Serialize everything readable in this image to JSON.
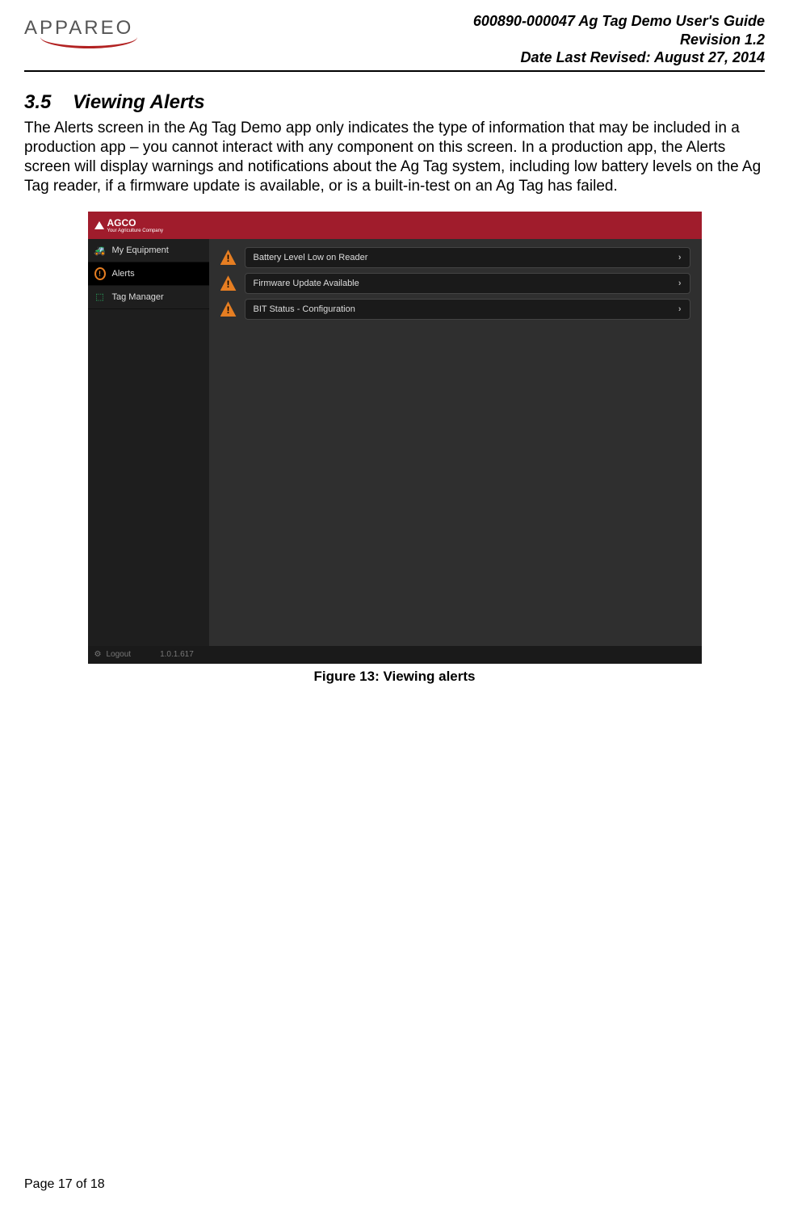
{
  "header": {
    "logo_text": "APPAREO",
    "doc_title": "600890-000047 Ag Tag Demo User's Guide",
    "revision": "Revision 1.2",
    "date": "Date Last Revised: August 27, 2014"
  },
  "section": {
    "number": "3.5",
    "title": "Viewing Alerts",
    "body": "The Alerts screen in the Ag Tag Demo app only indicates the type of information that may be included in a production app – you cannot interact with any component on this screen. In a production app, the Alerts screen will display warnings and notifications about the Ag Tag system, including low battery levels on the Ag Tag reader, if a firmware update is available, or is a built-in-test on an Ag Tag has failed."
  },
  "screenshot": {
    "brand": "AGCO",
    "brand_sub": "Your Agriculture Company",
    "sidebar": {
      "items": [
        {
          "label": "My Equipment"
        },
        {
          "label": "Alerts"
        },
        {
          "label": "Tag Manager"
        }
      ]
    },
    "alerts": [
      {
        "label": "Battery Level Low on Reader"
      },
      {
        "label": "Firmware Update Available"
      },
      {
        "label": "BIT Status - Configuration"
      }
    ],
    "footer": {
      "logout": "Logout",
      "version": "1.0.1.617"
    }
  },
  "caption": "Figure 13: Viewing alerts",
  "page_number": "Page 17 of 18"
}
